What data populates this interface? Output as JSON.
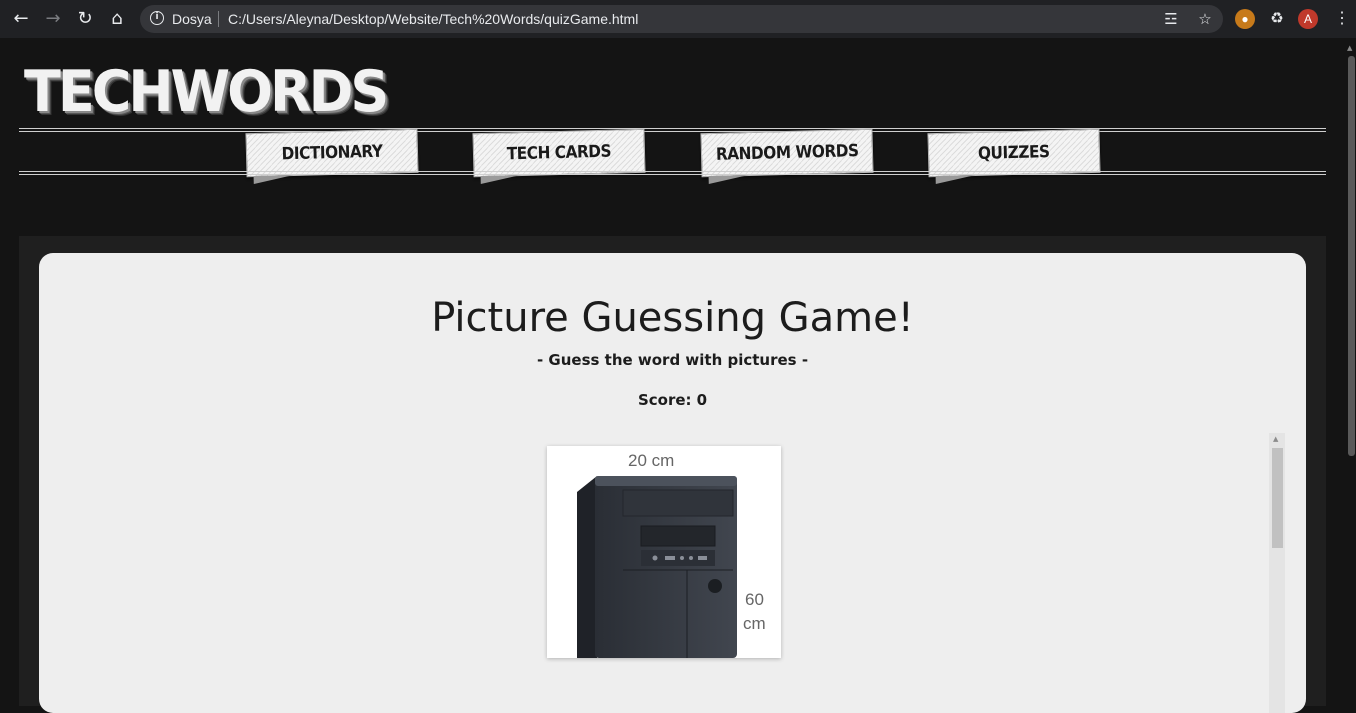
{
  "browser": {
    "site_label": "Dosya",
    "url": "C:/Users/Aleyna/Desktop/Website/Tech%20Words/quizGame.html",
    "profile_initial": "A"
  },
  "site": {
    "logo": "TECHWORDS",
    "nav": [
      {
        "label": "DICTIONARY"
      },
      {
        "label": "TECH CARDS"
      },
      {
        "label": "RANDOM WORDS"
      },
      {
        "label": "QUIZZES"
      }
    ]
  },
  "game": {
    "title": "Picture Guessing Game!",
    "subtitle": "- Guess the word with pictures -",
    "score_label": "Score:",
    "score_value": "0",
    "image": {
      "width_label": "20 cm",
      "height_label_1": "60",
      "height_label_2": "cm"
    }
  },
  "colors": {
    "page_bg": "#141414",
    "panel_bg": "#1f1f1f",
    "card_bg": "#eeeeee",
    "chrome_bg": "#202124"
  }
}
